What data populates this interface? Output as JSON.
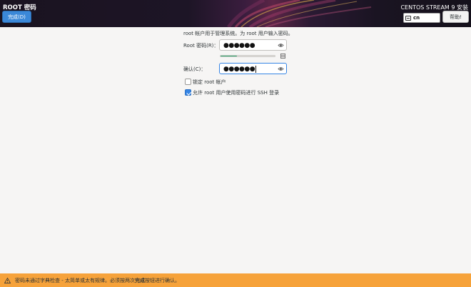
{
  "header": {
    "spoke_title": "ROOT 密码",
    "done_label": "完成(D)",
    "product_title": "CENTOS STREAM 9 安装",
    "keyboard_layout": "cn",
    "help_label": "帮助!"
  },
  "form": {
    "intro_text": "root 帐户用于管理系统。为 root 用户输入密码。",
    "password_label": "Root 密码(R)：",
    "password_value": "●●●●●●",
    "password_strength": 0.3,
    "confirm_label": "确认(C)：",
    "confirm_value": "●●●●●●",
    "lock_root_label": "锁定 root 帐户",
    "lock_root_checked": false,
    "allow_ssh_label": "允许 root 用户使用密码进行 SSH 登录",
    "allow_ssh_checked": true
  },
  "status": {
    "message_prefix": "密码未通过字典检查 - 太简单或太有规律。必须按两次",
    "message_bold": "完成",
    "message_suffix": "按钮进行确认。"
  },
  "colors": {
    "accent": "#3584e4",
    "warning_bar": "#f6a23a",
    "strength_fill": "#26a269"
  },
  "icons": [
    "keyboard-icon",
    "eye-icon",
    "strength-warning-icon",
    "warning-icon"
  ]
}
